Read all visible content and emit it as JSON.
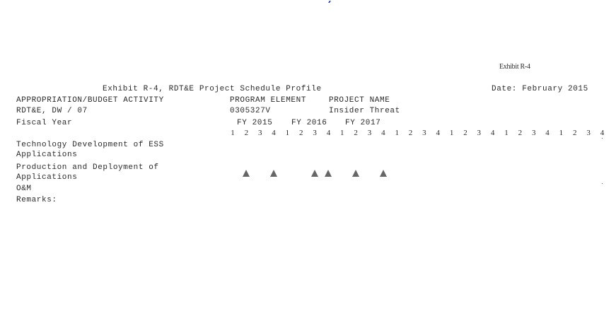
{
  "exhibit_tag": "Exhibit R-4",
  "header": {
    "title": "Exhibit R-4, RDT&E Project Schedule Profile",
    "date": "Date: February 2015"
  },
  "columns": {
    "approp_label": "APPROPRIATION/BUDGET ACTIVITY",
    "approp_value": "RDT&E, DW / 07",
    "pe_label": "PROGRAM ELEMENT",
    "pe_value": "0305327V",
    "project_label": "PROJECT NAME",
    "project_value": "Insider Threat"
  },
  "fiscal_year_label": "Fiscal Year",
  "years": [
    "FY 2015",
    "FY 2016",
    "FY 2017"
  ],
  "quarters": [
    "1",
    "2",
    "3",
    "4",
    "1",
    "2",
    "3",
    "4",
    "1",
    "2",
    "3",
    "4",
    "1",
    "2",
    "3",
    "4",
    "1",
    "2",
    "3",
    "4",
    "1",
    "2",
    "3",
    "4",
    "1",
    "2",
    "3",
    "4"
  ],
  "rows": {
    "row1_line1": "Technology Development of ESS",
    "row1_line2": "Applications",
    "row2_line1": "Production and Deployment of",
    "row2_line2": "Applications",
    "row3": "O&M",
    "row4": "Remarks:"
  },
  "milestones": {
    "row": "Production and Deployment of Applications",
    "quarter_indices": [
      1,
      3,
      6,
      7,
      9,
      11
    ]
  }
}
